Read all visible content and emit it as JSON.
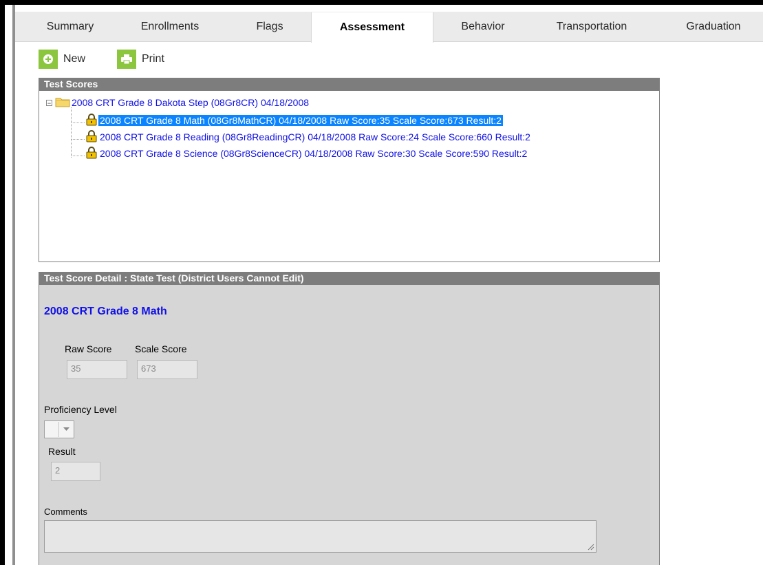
{
  "tabs": [
    {
      "label": "Summary",
      "active": false
    },
    {
      "label": "Enrollments",
      "active": false
    },
    {
      "label": "Flags",
      "active": false
    },
    {
      "label": "Assessment",
      "active": true
    },
    {
      "label": "Behavior",
      "active": false
    },
    {
      "label": "Transportation",
      "active": false
    },
    {
      "label": "Graduation",
      "active": false
    }
  ],
  "toolbar": {
    "new_label": "New",
    "new_icon": "plus-circle-icon",
    "print_label": "Print",
    "print_icon": "printer-icon"
  },
  "test_scores": {
    "header": "Test Scores",
    "root": {
      "label": "2008 CRT Grade 8 Dakota Step (08Gr8CR) 04/18/2008",
      "icon": "folder-icon",
      "expanded": true
    },
    "children": [
      {
        "label": "2008 CRT Grade 8 Math (08Gr8MathCR) 04/18/2008 Raw Score:35 Scale Score:673 Result:2",
        "icon": "lock-icon",
        "selected": true
      },
      {
        "label": "2008 CRT Grade 8 Reading (08Gr8ReadingCR) 04/18/2008 Raw Score:24 Scale Score:660 Result:2",
        "icon": "lock-icon",
        "selected": false
      },
      {
        "label": "2008 CRT Grade 8 Science (08Gr8ScienceCR) 04/18/2008 Raw Score:30 Scale Score:590 Result:2",
        "icon": "lock-icon",
        "selected": false
      }
    ]
  },
  "detail": {
    "header": "Test Score Detail : State Test (District Users Cannot Edit)",
    "title": "2008 CRT Grade 8 Math",
    "raw_score_label": "Raw Score",
    "raw_score_value": "35",
    "scale_score_label": "Scale Score",
    "scale_score_value": "673",
    "proficiency_label": "Proficiency Level",
    "proficiency_value": "",
    "result_label": "Result",
    "result_value": "2",
    "comments_label": "Comments",
    "comments_value": ""
  },
  "colors": {
    "link_blue": "#1010e8",
    "selection_blue": "#0a84ff",
    "panel_header_gray": "#7d7d7d",
    "detail_bg": "#d6d6d6",
    "toolbar_green": "#8cc63f"
  }
}
